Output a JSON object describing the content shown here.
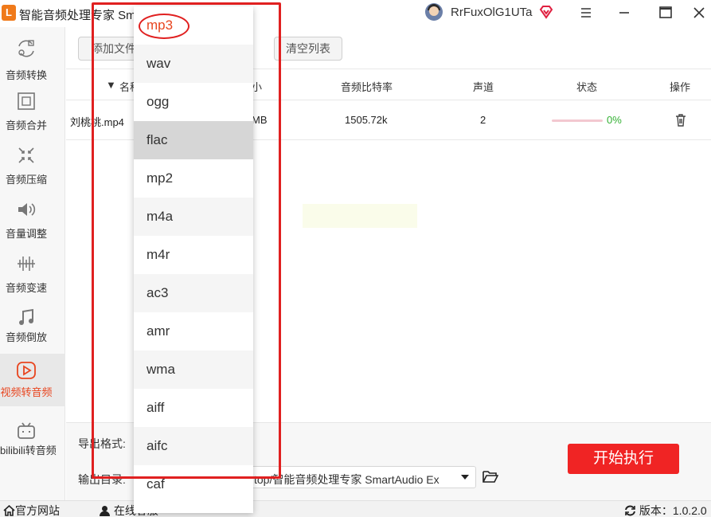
{
  "app": {
    "title": "智能音频处理专家 Sm",
    "logo_letter": "L",
    "username": "RrFuxOlG1UTa"
  },
  "sidebar": {
    "items": [
      {
        "label": "音频转换",
        "icon": "audio-convert-icon"
      },
      {
        "label": "音频合并",
        "icon": "audio-merge-icon"
      },
      {
        "label": "音频压缩",
        "icon": "audio-compress-icon"
      },
      {
        "label": "音量调整",
        "icon": "volume-icon"
      },
      {
        "label": "音频变速",
        "icon": "speed-icon"
      },
      {
        "label": "音频倒放",
        "icon": "music-note-icon"
      },
      {
        "label": "视频转音频",
        "icon": "play-icon"
      },
      {
        "label": "bilibili转音频",
        "icon": "bilibili-icon"
      }
    ],
    "active_index": 6
  },
  "toolbar": {
    "add_file": "添加文件",
    "clear_list": "清空列表"
  },
  "table": {
    "headers": {
      "name": "名称",
      "size_suffix": "小",
      "bitrate": "音频比特率",
      "channels": "声道",
      "status": "状态",
      "action": "操作"
    },
    "rows": [
      {
        "name": "刘桃桃.mp4",
        "size_suffix": "MB",
        "bitrate": "1505.72k",
        "channels": "2",
        "progress": 0,
        "progress_text": "0%"
      }
    ]
  },
  "settings": {
    "format_label": "导出格式:",
    "outdir_label": "输出目录:",
    "outdir_value": "top/智能音频处理专家 SmartAudio Ex"
  },
  "start_button": "开始执行",
  "statusbar": {
    "website": "官方网站",
    "online": "在线客服",
    "version": "版本：1.0.2.0"
  },
  "format_dropdown": {
    "options": [
      "mp3",
      "wav",
      "ogg",
      "flac",
      "mp2",
      "m4a",
      "m4r",
      "ac3",
      "amr",
      "wma",
      "aiff",
      "aifc",
      "caf"
    ],
    "selected": "mp3",
    "hovered": "flac"
  },
  "colors": {
    "accent_red": "#f02424",
    "active_orange": "#e8451f",
    "progress_green": "#33b033",
    "annotation_red": "#e02020"
  }
}
